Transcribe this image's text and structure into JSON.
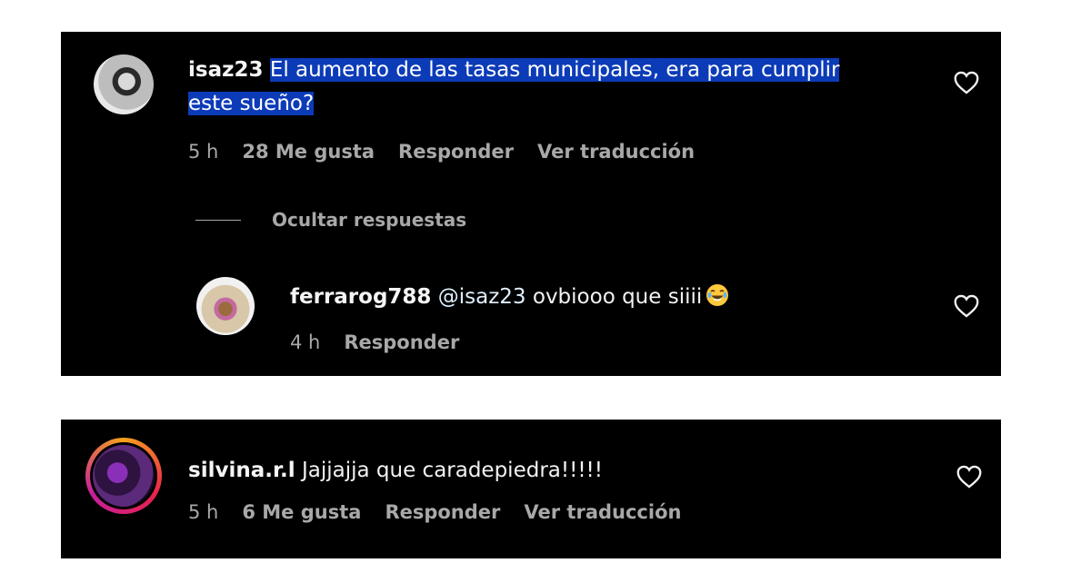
{
  "comments": [
    {
      "username": "isaz23",
      "text_line1": "El aumento de las tasas municipales, era para cumplir",
      "text_line2": "este sueño?",
      "time": "5 h",
      "likes": "28 Me gusta",
      "reply_label": "Responder",
      "translate_label": "Ver traducción",
      "hide_replies_label": "Ocultar respuestas",
      "replies": [
        {
          "username": "ferrarog788",
          "mention": "@isaz23",
          "text": "ovbiooo que siiii",
          "emoji_icon": "face-with-tears-of-joy-emoji",
          "time": "4 h",
          "reply_label": "Responder"
        }
      ]
    },
    {
      "username": "silvina.r.l",
      "text": "Jajjajja que caradepiedra!!!!!",
      "time": "5 h",
      "likes": "6 Me gusta",
      "reply_label": "Responder",
      "translate_label": "Ver traducción"
    }
  ],
  "icons": {
    "like": "heart-outline-icon"
  },
  "colors": {
    "panel_background": "#000000",
    "text_highlight": "#0c3bb8",
    "secondary_text": "#a8a8a8",
    "story_ring": "#e8224d"
  }
}
